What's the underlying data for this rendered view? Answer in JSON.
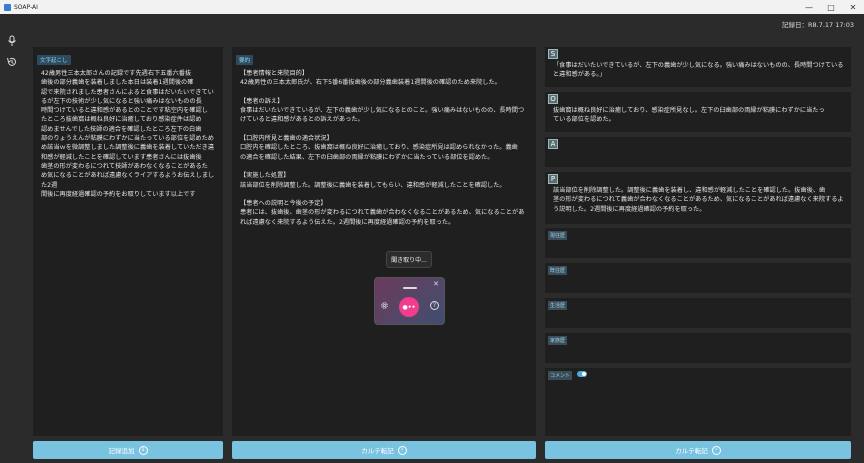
{
  "window": {
    "title": "SOAP-AI"
  },
  "header": {
    "record_date": "記録日：R8.7.17 17:03"
  },
  "transcript": {
    "label": "文字起こし",
    "text": "42歳男性三本太郎さんの記録です先週右下五番六番抜\n歯後の部分義歯を装着しました本日は装着1週間後の確\n認で来院されました患者さんによると食事はだいたいできてい\nるが左下の技術が少し気になると強い痛みはないものの長\n時間つけていると違和感があるとのことです粘空内を確認し\nたところ抜歯窩は概ね良好に治癒しており感染症件は認め\n認めませんでした技師の適合を確認したところ左下の白歯\n部のりょうえんが粘膜にわずかに当たっている部位を認めため\nめ該当ｗを微調整しました調整後に義歯を装着していただき違\n和感が軽減したことを確認しています患者さんには抜歯後\n歯茎の形が変わるにつれて技師があわなくなることがあるた\nめ気になることがあれば遠慮なくライアするようお伝えしました2週\n間後に再度経過確認の予約をお取りしています以上です"
  },
  "summary": {
    "label": "要約",
    "text": "【患者情報と来院目的】\n42歳男性の三本太郎氏が、右下5番6番抜歯後の部分義歯装着1週間後の確認のため来院した。\n\n【患者の訴え】\n食事はだいたいできているが、左下の義歯が少し気になるとのこと。強い痛みはないものの、長時間つ\nけていると違和感があるとの訴えがあった。\n\n【口腔内所見と義歯の適合状況】\n口腔内を確認したところ、抜歯窩は概ね良好に治癒しており、感染症所見は認められなかった。義歯\nの適合を確認した結果、左下の臼歯部の両縁が粘膜にわずかに当たっている部位を認めた。\n\n【実施した処置】\n該当部位を削除調整した。調整後に義歯を装着してもらい、違和感が軽減したことを確認した。\n\n【患者への説明と今後の予定】\n患者には、抜歯後、歯茎の形が変わるにつれて義歯が合わなくなることがあるため、気になることがあ\nれば遠慮なく来院するよう伝えた。2週間後に再度経過確認の予約を取った。"
  },
  "soap": {
    "s": {
      "letter": "S",
      "text": "「食事はだいたいできているが、左下の義歯が少し気になる。強い痛みはないものの、長時間つけている\nと違和感がある。」"
    },
    "o": {
      "letter": "O",
      "text": "抜歯窩は概ね良好に治癒しており、感染症所見なし。左下の臼歯部の両縁が粘膜にわずかに当たっ\nている部位を認めた。"
    },
    "a": {
      "letter": "A",
      "text": ""
    },
    "p": {
      "letter": "P",
      "text": "該当部位を削除調整した。調整後に義歯を装着し、違和感が軽減したことを確認した。抜歯後、歯\n茎の形が変わるにつれて義歯が合わなくなることがあるため、気になることがあれば遠慮なく来院するよ\nう説明した。2週間後に再度経過確認の予約を取った。"
    }
  },
  "extra": {
    "current_history": "現往歴",
    "past_history": "既往歴",
    "lifestyle": "生活歴",
    "family_history": "家族歴",
    "comment": "コメント"
  },
  "buttons": {
    "add_record": "記録追加",
    "chart_transfer_1": "カルテ転記",
    "chart_transfer_2": "カルテ転記"
  },
  "recorder": {
    "tooltip": "聞き取り中..."
  }
}
